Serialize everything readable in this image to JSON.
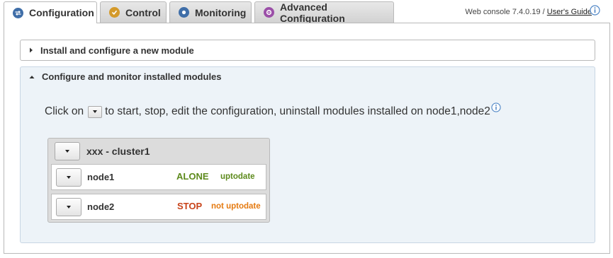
{
  "tabs": [
    {
      "label": "Configuration",
      "icon": "configuration-icon",
      "active": true
    },
    {
      "label": "Control",
      "icon": "check-icon",
      "active": false
    },
    {
      "label": "Monitoring",
      "icon": "monitoring-icon",
      "active": false
    },
    {
      "label": "Advanced Configuration",
      "icon": "gear-icon",
      "active": false
    }
  ],
  "header": {
    "version_text": "Web console 7.4.0.19 / ",
    "guide_link": "User's Guide"
  },
  "sections": {
    "install": {
      "title": "Install and configure a new module",
      "expanded": false
    },
    "monitor": {
      "title": "Configure and monitor installed modules",
      "expanded": true
    }
  },
  "instruction": {
    "prefix": "Click on",
    "suffix": "to start, stop, edit the configuration, uninstall modules installed on node1,node2"
  },
  "cluster": {
    "title": "xxx - cluster1",
    "nodes": [
      {
        "name": "node1",
        "state": "ALONE",
        "state_color": "#5d8a1c",
        "sync": "uptodate",
        "sync_color": "#5d8a1c"
      },
      {
        "name": "node2",
        "state": "STOP",
        "state_color": "#c8431a",
        "sync": "not uptodate",
        "sync_color": "#e57a10"
      }
    ]
  },
  "colors": {
    "section_bg": "#edf3f8",
    "info_icon": "#4f86c6"
  }
}
